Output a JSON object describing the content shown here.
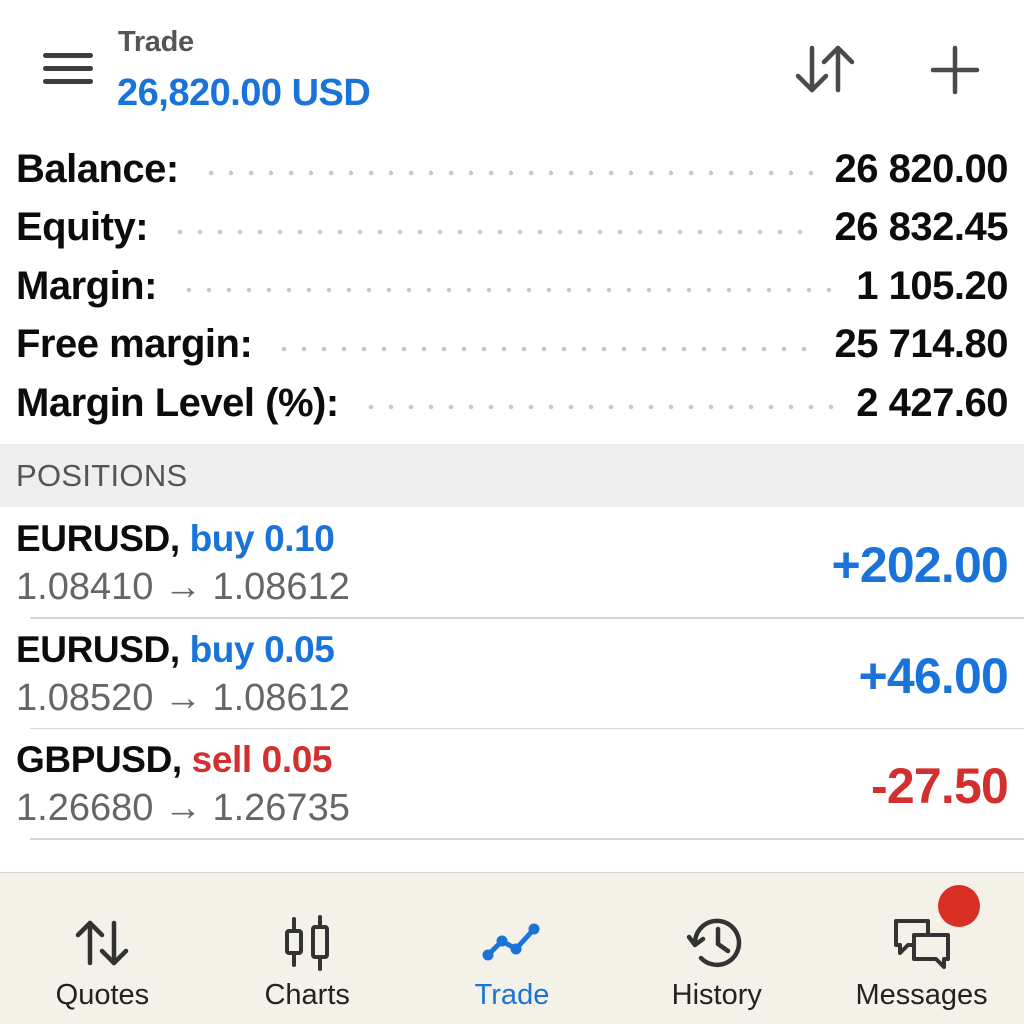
{
  "header": {
    "title": "Trade",
    "balance_display": "26,820.00 USD",
    "icons": {
      "menu": "hamburger-menu-icon",
      "sort": "sort-arrows-icon",
      "add": "plus-icon"
    }
  },
  "summary": [
    {
      "label": "Balance:",
      "value": "26 820.00"
    },
    {
      "label": "Equity:",
      "value": "26 832.45"
    },
    {
      "label": "Margin:",
      "value": "1 105.20"
    },
    {
      "label": "Free margin:",
      "value": "25 714.80"
    },
    {
      "label": "Margin Level (%):",
      "value": "2 427.60"
    }
  ],
  "positions_header": "POSITIONS",
  "positions": [
    {
      "symbol": "EURUSD,",
      "direction": "buy 0.10",
      "type": "buy",
      "prices": "1.08410 → 1.08612",
      "profit": "+202.00"
    },
    {
      "symbol": "EURUSD,",
      "direction": "buy 0.05",
      "type": "buy",
      "prices": "1.08520 → 1.08612",
      "profit": "+46.00"
    },
    {
      "symbol": "GBPUSD,",
      "direction": "sell 0.05",
      "type": "sell",
      "prices": "1.26680 → 1.26735",
      "profit": "-27.50"
    }
  ],
  "nav": [
    {
      "label": "Quotes",
      "icon": "quotes-arrows-icon",
      "active": false
    },
    {
      "label": "Charts",
      "icon": "candlestick-chart-icon",
      "active": false
    },
    {
      "label": "Trade",
      "icon": "trade-line-icon",
      "active": true
    },
    {
      "label": "History",
      "icon": "history-clock-icon",
      "active": false
    },
    {
      "label": "Messages",
      "icon": "messages-chat-icon",
      "active": false,
      "badge": true
    }
  ],
  "colors": {
    "accent": "#1a73d9",
    "loss": "#d32f2f",
    "badge": "#d93025",
    "nav_background": "#f3f1e8",
    "section_background": "#efefef"
  }
}
